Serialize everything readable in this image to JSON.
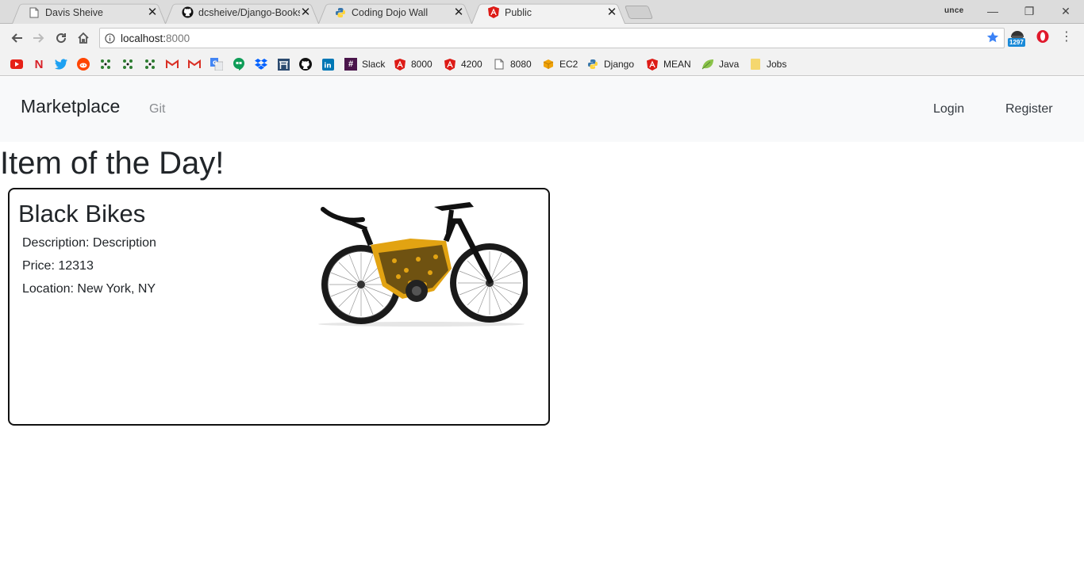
{
  "browser": {
    "tabs": [
      {
        "title": "Davis Sheive",
        "icon": "document-icon",
        "active": false
      },
      {
        "title": "dcsheive/Django-Books",
        "icon": "github-icon",
        "active": false
      },
      {
        "title": "Coding Dojo Wall",
        "icon": "python-icon",
        "active": false
      },
      {
        "title": "Public",
        "icon": "angular-icon",
        "active": true
      }
    ],
    "profile_label": "unce",
    "address": {
      "host": "localhost:",
      "port": "8000"
    },
    "extension_badge": "1297",
    "bookmarks": [
      {
        "label": "",
        "icon": "youtube-icon",
        "color": "#e62117"
      },
      {
        "label": "",
        "icon": "netflix-icon",
        "color": "#d81f26"
      },
      {
        "label": "",
        "icon": "twitter-icon",
        "color": "#1da1f2"
      },
      {
        "label": "",
        "icon": "reddit-icon",
        "color": "#ff4500"
      },
      {
        "label": "",
        "icon": "grid-icon",
        "color": "#2e7d32"
      },
      {
        "label": "",
        "icon": "grid-icon",
        "color": "#2e7d32"
      },
      {
        "label": "",
        "icon": "grid-icon",
        "color": "#2e7d32"
      },
      {
        "label": "",
        "icon": "gmail-icon",
        "color": "#d93025"
      },
      {
        "label": "",
        "icon": "gmail-icon",
        "color": "#d93025"
      },
      {
        "label": "",
        "icon": "translate-icon",
        "color": "#4285f4"
      },
      {
        "label": "",
        "icon": "hangouts-icon",
        "color": "#0f9d58"
      },
      {
        "label": "",
        "icon": "dropbox-icon",
        "color": "#0061ff"
      },
      {
        "label": "",
        "icon": "torii-icon",
        "color": "#2b4a6f"
      },
      {
        "label": "",
        "icon": "github-icon",
        "color": "#111111"
      },
      {
        "label": "",
        "icon": "linkedin-icon",
        "color": "#0077b5"
      },
      {
        "label": "Slack",
        "icon": "slack-icon",
        "color": "#4a154b"
      },
      {
        "label": "8000",
        "icon": "angular-icon",
        "color": "#dd1b16"
      },
      {
        "label": "4200",
        "icon": "angular-icon",
        "color": "#dd1b16"
      },
      {
        "label": "8080",
        "icon": "document-icon",
        "color": "#666666"
      },
      {
        "label": "EC2",
        "icon": "aws-box-icon",
        "color": "#f0a30a"
      },
      {
        "label": "Django",
        "icon": "python-icon",
        "color": "#3776ab"
      },
      {
        "label": "MEAN",
        "icon": "angular-icon",
        "color": "#dd1b16"
      },
      {
        "label": "Java",
        "icon": "leaf-icon",
        "color": "#8bc34a"
      },
      {
        "label": "Jobs",
        "icon": "folder-icon",
        "color": "#f5d76e"
      }
    ]
  },
  "navbar": {
    "brand": "Marketplace",
    "links": {
      "git": "Git",
      "login": "Login",
      "register": "Register"
    }
  },
  "page": {
    "heading": "Item of the Day!",
    "item": {
      "name": "Black Bikes",
      "description_label": "Description: ",
      "description": "Description",
      "price_label": "Price: ",
      "price": "12313",
      "location_label": "Location: ",
      "location": "New York, NY",
      "image_icon": "bike-image"
    }
  }
}
